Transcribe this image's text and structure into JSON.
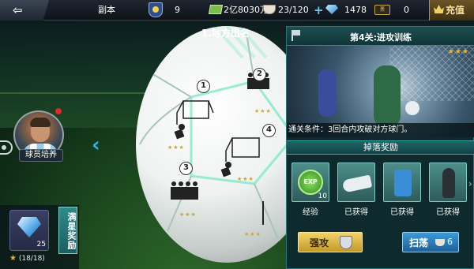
{
  "topbar": {
    "back_label": "⇦",
    "mode": "副本",
    "trophies": "9",
    "money": "2亿8030万",
    "stamina": "23/120",
    "diamonds": "1478",
    "tickets": "0",
    "ticket_icon_text": "票",
    "recharge": "充值"
  },
  "stage": {
    "title": "1.地方出名",
    "panels": [
      {
        "num": "1",
        "stars": "★★★"
      },
      {
        "num": "2",
        "stars": "★★★"
      },
      {
        "num": "3",
        "stars": "★★★"
      },
      {
        "num": "4",
        "stars": "★★★"
      },
      {
        "num": "",
        "stars": "★★★"
      },
      {
        "num": "",
        "stars": "★★★"
      }
    ]
  },
  "player": {
    "label": "球员培养"
  },
  "reward": {
    "count": "25",
    "tag": "满星奖励",
    "progress": "(18/18)"
  },
  "panel": {
    "title": "第4关:进攻训练",
    "stars": "★★★",
    "condition": "通关条件：3回合内攻破对方球门。",
    "drop_header": "掉落奖励",
    "items": [
      {
        "icon": "exp-icon",
        "text": "EXP",
        "qty": "10",
        "label": "经验"
      },
      {
        "icon": "boot-icon",
        "text": "",
        "qty": "",
        "label": "已获得"
      },
      {
        "icon": "vest-icon",
        "text": "",
        "qty": "",
        "label": "已获得"
      },
      {
        "icon": "shinguard-icon",
        "text": "",
        "qty": "",
        "label": "已获得"
      }
    ],
    "attack_label": "强攻",
    "sweep_label": "扫荡",
    "sweep_count": "6"
  },
  "colors": {
    "accent": "#2fb6e6",
    "gold": "#e6b93f",
    "panel": "#0e2a2d",
    "teal": "#2f8e8d"
  }
}
